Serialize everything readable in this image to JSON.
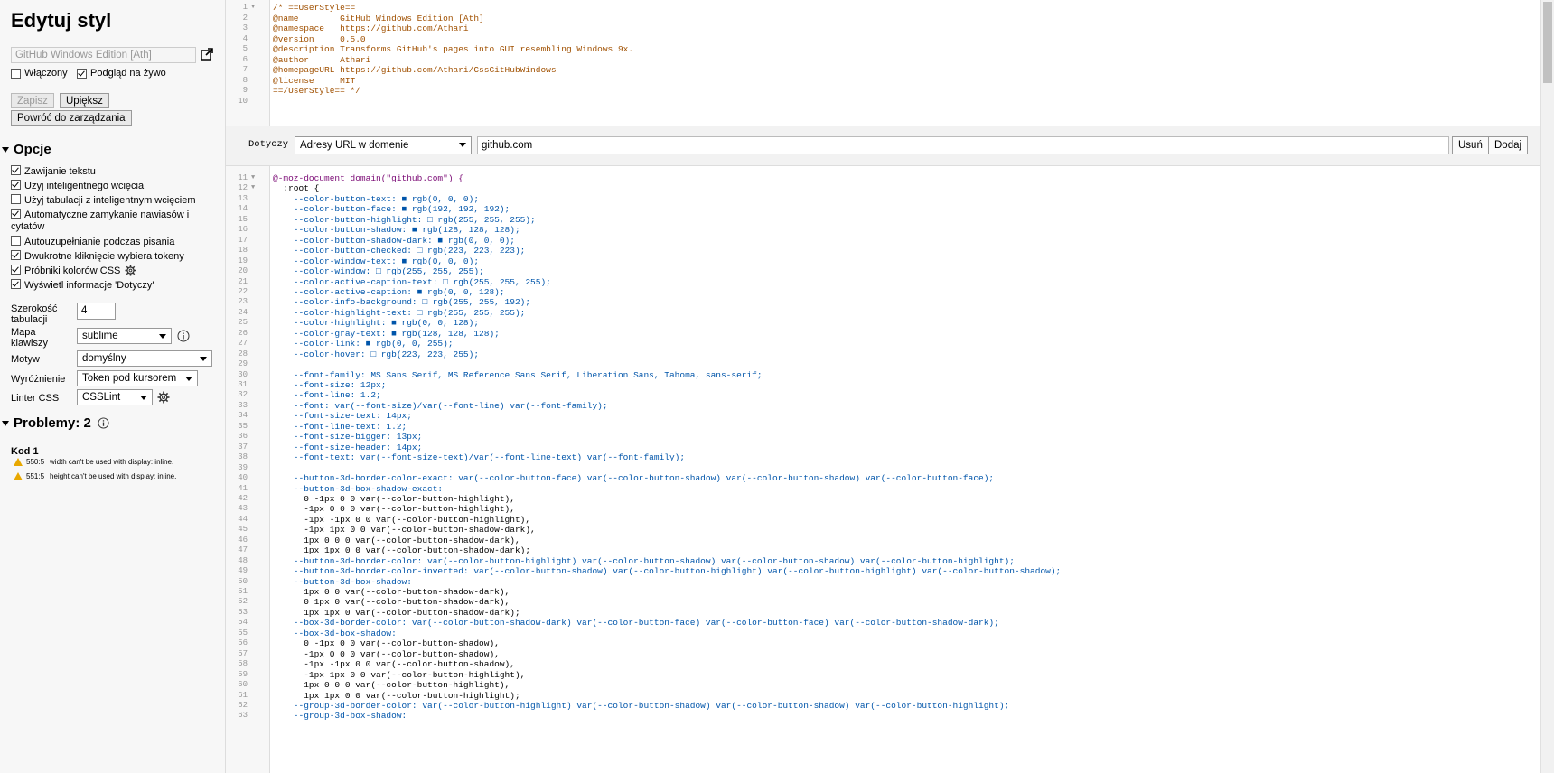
{
  "sidebar": {
    "title": "Edytuj styl",
    "name_value": "GitHub Windows Edition [Ath]",
    "enabled_label": "Włączony",
    "live_preview_label": "Podgląd na żywo",
    "save_label": "Zapisz",
    "beautify_label": "Upiększ",
    "back_label": "Powróć do zarządzania",
    "options_heading": "Opcje",
    "options": [
      {
        "label": "Zawijanie tekstu",
        "checked": true
      },
      {
        "label": "Użyj inteligentnego wcięcia",
        "checked": true
      },
      {
        "label": "Użyj tabulacji z inteligentnym wcięciem",
        "checked": false
      },
      {
        "label": "Automatyczne zamykanie nawiasów i cytatów",
        "checked": true
      },
      {
        "label": "Autouzupełnianie podczas pisania",
        "checked": false
      },
      {
        "label": "Dwukrotne kliknięcie wybiera tokeny",
        "checked": true
      },
      {
        "label": "Próbniki kolorów CSS",
        "checked": true
      },
      {
        "label": "Wyświetl informacje 'Dotyczy'",
        "checked": true
      }
    ],
    "tab_width_label": "Szerokość tabulacji",
    "tab_width_value": "4",
    "keymap_label": "Mapa klawiszy",
    "keymap_value": "sublime",
    "theme_label": "Motyw",
    "theme_value": "domyślny",
    "highlight_label": "Wyróżnienie",
    "highlight_value": "Token pod kursorem",
    "linter_label": "Linter CSS",
    "linter_value": "CSSLint",
    "problems_heading": "Problemy: 2",
    "code_label": "Kod 1",
    "problems": [
      {
        "pos": "550:5",
        "msg": "width can't be used with display: inline."
      },
      {
        "pos": "551:5",
        "msg": "height can't be used with display: inline."
      }
    ]
  },
  "applies": {
    "label": "Dotyczy",
    "type_value": "Adresy URL w domenie",
    "value": "github.com",
    "remove_label": "Usuń",
    "add_label": "Dodaj"
  },
  "header_code": {
    "start": 1,
    "lines": [
      "/* ==UserStyle==",
      "@name        GitHub Windows Edition [Ath]",
      "@namespace   https://github.com/Athari",
      "@version     0.5.0",
      "@description Transforms GitHub's pages into GUI resembling Windows 9x.",
      "@author      Athari",
      "@homepageURL https://github.com/Athari/CssGitHubWindows",
      "@license     MIT",
      "==/UserStyle== */",
      ""
    ]
  },
  "main_code": {
    "start": 11,
    "lines": [
      "@-moz-document domain(\"github.com\") {",
      "  :root {",
      "    --color-button-text: ■ rgb(0, 0, 0);",
      "    --color-button-face: ■ rgb(192, 192, 192);",
      "    --color-button-highlight: □ rgb(255, 255, 255);",
      "    --color-button-shadow: ■ rgb(128, 128, 128);",
      "    --color-button-shadow-dark: ■ rgb(0, 0, 0);",
      "    --color-button-checked: □ rgb(223, 223, 223);",
      "    --color-window-text: ■ rgb(0, 0, 0);",
      "    --color-window: □ rgb(255, 255, 255);",
      "    --color-active-caption-text: □ rgb(255, 255, 255);",
      "    --color-active-caption: ■ rgb(0, 0, 128);",
      "    --color-info-background: □ rgb(255, 255, 192);",
      "    --color-highlight-text: □ rgb(255, 255, 255);",
      "    --color-highlight: ■ rgb(0, 0, 128);",
      "    --color-gray-text: ■ rgb(128, 128, 128);",
      "    --color-link: ■ rgb(0, 0, 255);",
      "    --color-hover: □ rgb(223, 223, 255);",
      "",
      "    --font-family: MS Sans Serif, MS Reference Sans Serif, Liberation Sans, Tahoma, sans-serif;",
      "    --font-size: 12px;",
      "    --font-line: 1.2;",
      "    --font: var(--font-size)/var(--font-line) var(--font-family);",
      "    --font-size-text: 14px;",
      "    --font-line-text: 1.2;",
      "    --font-size-bigger: 13px;",
      "    --font-size-header: 14px;",
      "    --font-text: var(--font-size-text)/var(--font-line-text) var(--font-family);",
      "",
      "    --button-3d-border-color-exact: var(--color-button-face) var(--color-button-shadow) var(--color-button-shadow) var(--color-button-face);",
      "    --button-3d-box-shadow-exact:",
      "      0 -1px 0 0 var(--color-button-highlight),",
      "      -1px 0 0 0 var(--color-button-highlight),",
      "      -1px -1px 0 0 var(--color-button-highlight),",
      "      -1px 1px 0 0 var(--color-button-shadow-dark),",
      "      1px 0 0 0 var(--color-button-shadow-dark),",
      "      1px 1px 0 0 var(--color-button-shadow-dark);",
      "    --button-3d-border-color: var(--color-button-highlight) var(--color-button-shadow) var(--color-button-shadow) var(--color-button-highlight);",
      "    --button-3d-border-color-inverted: var(--color-button-shadow) var(--color-button-highlight) var(--color-button-highlight) var(--color-button-shadow);",
      "    --button-3d-box-shadow:",
      "      1px 0 0 var(--color-button-shadow-dark),",
      "      0 1px 0 var(--color-button-shadow-dark),",
      "      1px 1px 0 var(--color-button-shadow-dark);",
      "    --box-3d-border-color: var(--color-button-shadow-dark) var(--color-button-face) var(--color-button-face) var(--color-button-shadow-dark);",
      "    --box-3d-box-shadow:",
      "      0 -1px 0 0 var(--color-button-shadow),",
      "      -1px 0 0 0 var(--color-button-shadow),",
      "      -1px -1px 0 0 var(--color-button-shadow),",
      "      -1px 1px 0 0 var(--color-button-highlight),",
      "      1px 0 0 0 var(--color-button-highlight),",
      "      1px 1px 0 0 var(--color-button-highlight);",
      "    --group-3d-border-color: var(--color-button-highlight) var(--color-button-shadow) var(--color-button-shadow) var(--color-button-highlight);",
      "    --group-3d-box-shadow:"
    ]
  },
  "colors": {
    "sidebar_bg": "#f7f7f7",
    "comment": "#a05000",
    "property": "#0055aa"
  }
}
